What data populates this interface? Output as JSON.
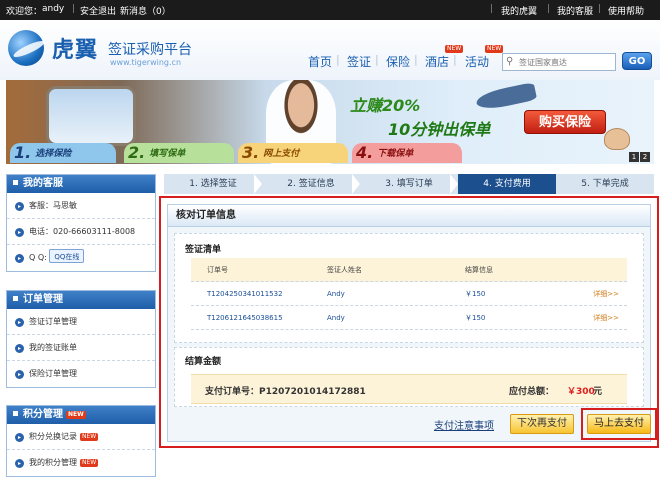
{
  "topbar": {
    "welcome": "欢迎您：",
    "user": "andy",
    "logout": "安全退出",
    "messages": "新消息（0）",
    "my_tigerwing": "我的虎翼",
    "my_service": "我的客服",
    "help": "使用帮助"
  },
  "header": {
    "logo_cn": "虎翼",
    "logo_sub": "签证采购平台",
    "logo_url": "www.tigerwing.cn",
    "nav": [
      "首页",
      "签证",
      "保险",
      "酒店",
      "活动"
    ],
    "new_badge": "NEW",
    "search_placeholder": "签证国家直达",
    "go": "GO"
  },
  "banner": {
    "line1": "立赚20%",
    "line2": "10分钟出保单",
    "buy": "购买保险",
    "page_1": "1",
    "page_2": "2",
    "steps": [
      {
        "num": "1.",
        "label": "选择保险"
      },
      {
        "num": "2.",
        "label": "填写保单"
      },
      {
        "num": "3.",
        "label": "网上支付"
      },
      {
        "num": "4.",
        "label": "下载保单"
      }
    ]
  },
  "sidebar": {
    "service": {
      "title": "我的客服",
      "rep": "客服：马思敏",
      "phone": "电话：020-66603111-8008",
      "qq": "Q Q:",
      "qq_btn": "QQ在线"
    },
    "orders": {
      "title": "订单管理",
      "items": [
        "签证订单管理",
        "我的签证账单",
        "保险订单管理"
      ]
    },
    "points": {
      "title": "积分管理",
      "items": [
        "积分兑换记录",
        "我的积分管理"
      ],
      "hot": "NEW"
    }
  },
  "process": {
    "steps": [
      "1. 选择签证",
      "2. 签证信息",
      "3. 填写订单",
      "4. 支付费用",
      "5. 下单完成"
    ],
    "active_index": 3
  },
  "order": {
    "title": "核对订单信息",
    "visa_list_title": "签证清单",
    "columns": [
      "订单号",
      "签证人姓名",
      "结算信息"
    ],
    "rows": [
      {
        "id": "T1204250341011532",
        "name": "Andy",
        "price": "￥150",
        "detail": "详细>>"
      },
      {
        "id": "T1206121645038615",
        "name": "Andy",
        "price": "￥150",
        "detail": "详细>>"
      }
    ],
    "settlement_title": "结算金额",
    "pay_order_label": "支付订单号：P1207201014172881",
    "total_label": "应付总额：",
    "total_amount": "￥300",
    "total_unit": "元",
    "pay_note": "支付注意事项",
    "pay_later": "下次再支付",
    "pay_now": "马上去支付"
  }
}
